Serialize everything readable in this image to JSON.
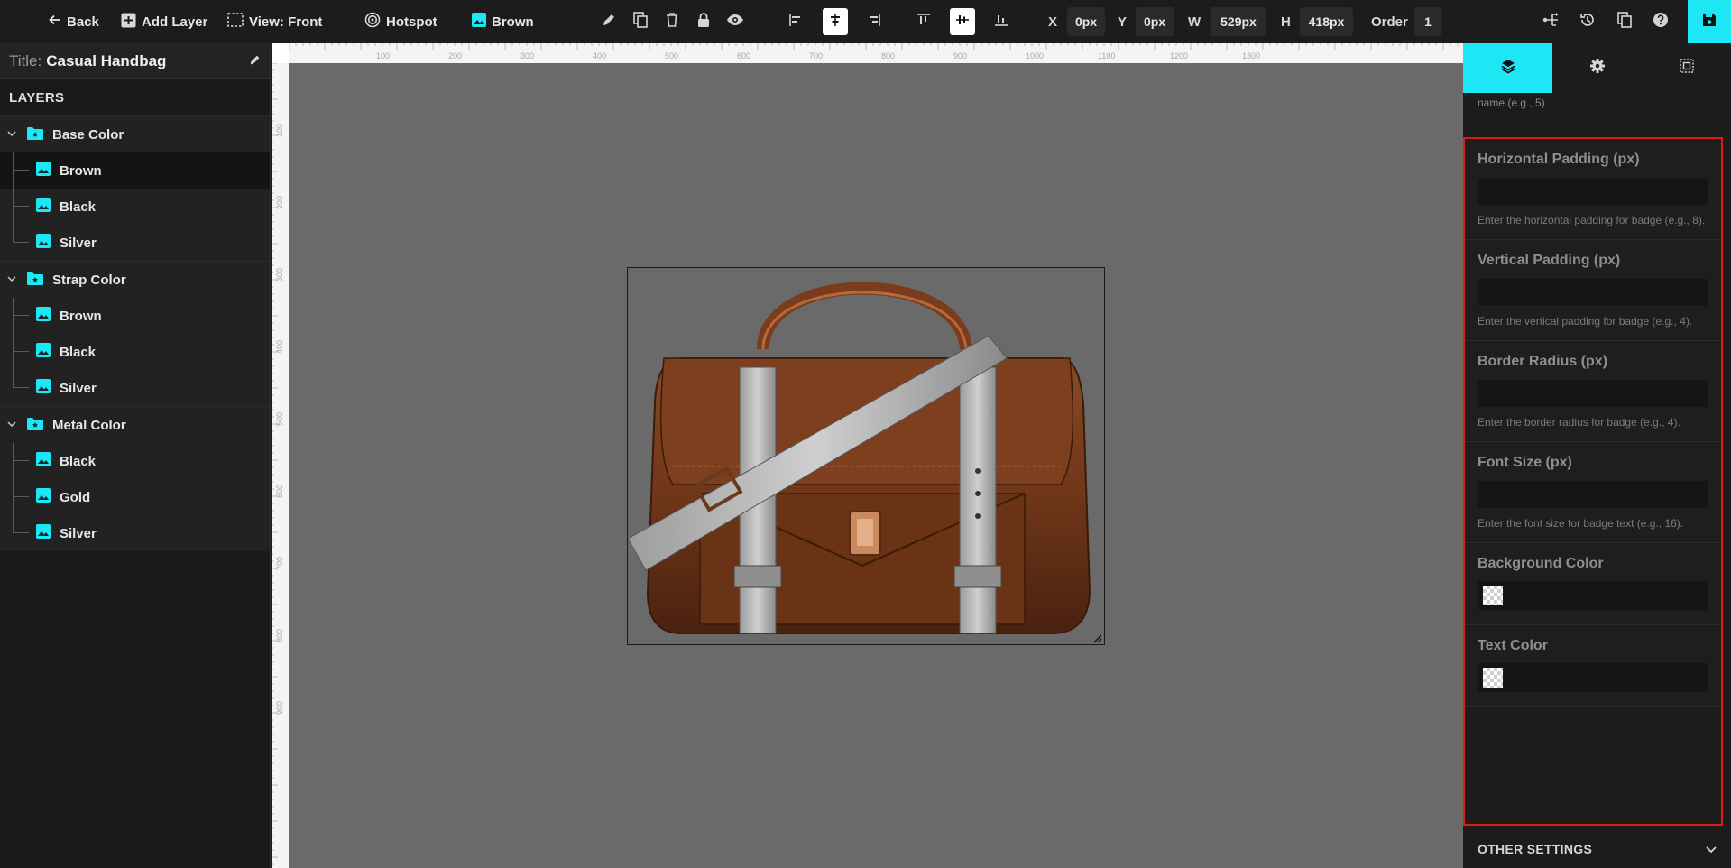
{
  "toolbar": {
    "back_label": "Back",
    "add_layer_label": "Add Layer",
    "view_label": "View: Front",
    "hotspot_label": "Hotspot",
    "current_layer_label": "Brown",
    "x_label": "X",
    "x_value": "0px",
    "y_label": "Y",
    "y_value": "0px",
    "w_label": "W",
    "w_value": "529px",
    "h_label": "H",
    "h_value": "418px",
    "order_label": "Order",
    "order_value": "1"
  },
  "left_panel": {
    "title_label": "Title:",
    "title_value": "Casual Handbag",
    "layers_header": "LAYERS",
    "groups": [
      {
        "name": "Base Color",
        "items": [
          "Brown",
          "Black",
          "Silver"
        ]
      },
      {
        "name": "Strap Color",
        "items": [
          "Brown",
          "Black",
          "Silver"
        ]
      },
      {
        "name": "Metal Color",
        "items": [
          "Black",
          "Gold",
          "Silver"
        ]
      }
    ]
  },
  "ruler": {
    "top_labels": [
      "100",
      "200",
      "300",
      "400",
      "500",
      "600",
      "700",
      "800",
      "900",
      "1000",
      "1100",
      "1200",
      "1300"
    ],
    "left_labels": [
      "100",
      "200",
      "300",
      "400",
      "500",
      "600",
      "700",
      "800",
      "900"
    ]
  },
  "right_panel": {
    "cut_text": "name (e.g., 5).",
    "fields": [
      {
        "label": "Horizontal Padding (px)",
        "help": "Enter the horizontal padding for badge (e.g., 8)."
      },
      {
        "label": "Vertical Padding (px)",
        "help": "Enter the vertical padding for badge (e.g., 4)."
      },
      {
        "label": "Border Radius (px)",
        "help": "Enter the border radius for badge (e.g., 4)."
      },
      {
        "label": "Font Size (px)",
        "help": "Enter the font size for badge text (e.g., 16)."
      }
    ],
    "color_fields": [
      {
        "label": "Background Color"
      },
      {
        "label": "Text Color"
      }
    ],
    "other_settings": "OTHER SETTINGS"
  },
  "colors": {
    "accent": "#1ee7f5",
    "highlight_border": "#e01919",
    "canvas_bg": "#6a6a6a"
  }
}
